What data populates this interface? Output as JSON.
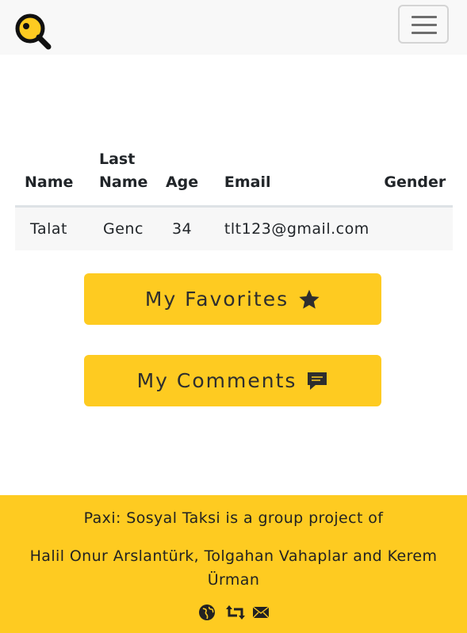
{
  "navbar": {
    "logo_icon": "magnifier-logo-icon",
    "menu_icon": "hamburger-icon",
    "accent": "#fecb21"
  },
  "profile_table": {
    "headers": {
      "name": "Name",
      "last_name_1": "Last",
      "last_name_2": "Name",
      "age": "Age",
      "email": "Email",
      "gender": "Gender"
    },
    "rows": [
      {
        "name": "Talat",
        "last_name": "Genc",
        "age": "34",
        "email": "tlt123@gmail.com",
        "gender": ""
      }
    ]
  },
  "buttons": {
    "favorites_label": "My Favorites",
    "favorites_icon": "star-icon",
    "comments_label": "My Comments",
    "comments_icon": "comment-icon"
  },
  "footer": {
    "line1": "Paxi: Sosyal Taksi is a group project of",
    "line2": "Halil Onur Arslantürk, Tolgahan Vahaplar and Kerem Ürman",
    "icons": [
      "globe-icon",
      "retweet-icon",
      "envelope-icon"
    ]
  }
}
